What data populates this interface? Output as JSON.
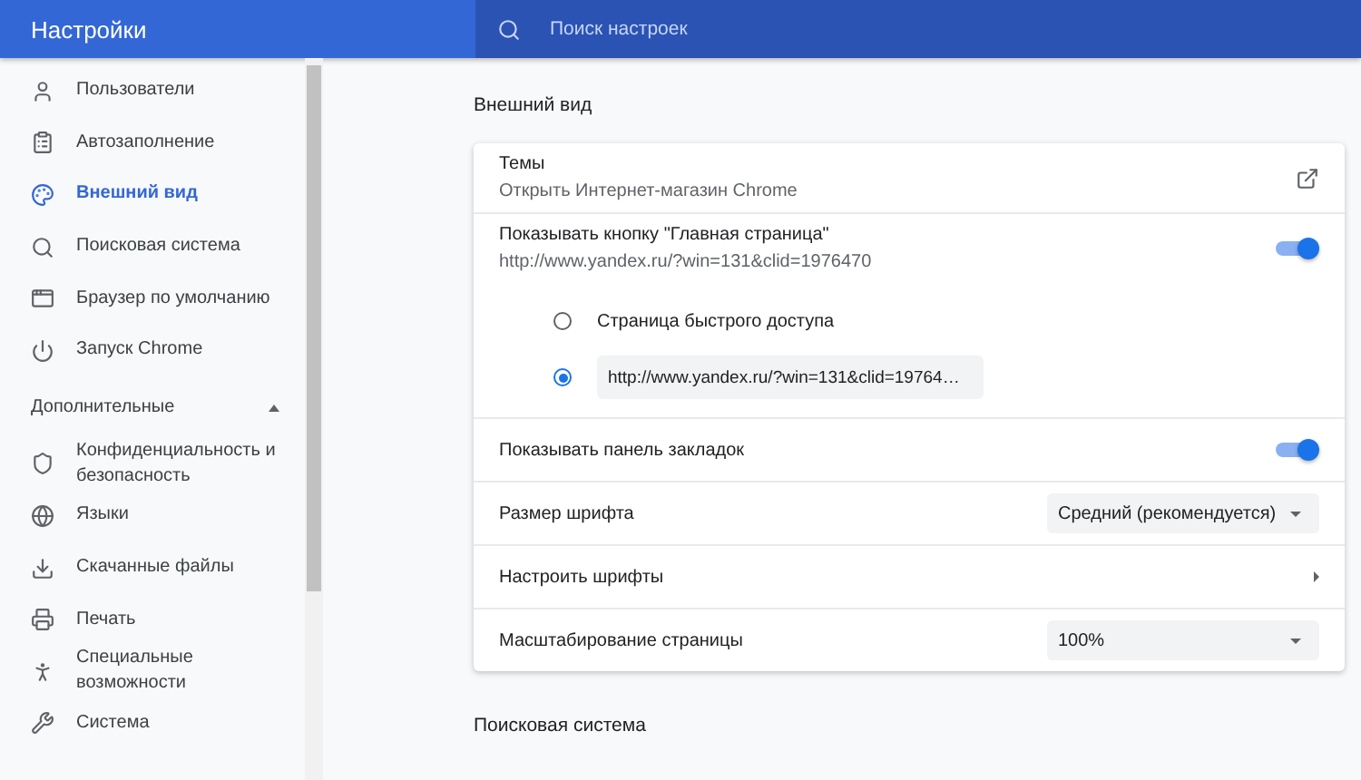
{
  "header": {
    "title": "Настройки"
  },
  "search": {
    "placeholder": "Поиск настроек"
  },
  "sidebar": {
    "items": [
      {
        "label": "Пользователи",
        "selected": false
      },
      {
        "label": "Автозаполнение",
        "selected": false
      },
      {
        "label": "Внешний вид",
        "selected": true
      },
      {
        "label": "Поисковая система",
        "selected": false
      },
      {
        "label": "Браузер по умолчанию",
        "selected": false
      },
      {
        "label": "Запуск Chrome",
        "selected": false
      }
    ],
    "advanced": {
      "label": "Дополнительные",
      "expanded": true
    },
    "advanced_items": [
      {
        "label": "Конфиденциальность и безопасность",
        "selected": false
      },
      {
        "label": "Языки",
        "selected": false
      },
      {
        "label": "Скачанные файлы",
        "selected": false
      },
      {
        "label": "Печать",
        "selected": false
      },
      {
        "label": "Специальные возможности",
        "selected": false
      },
      {
        "label": "Система",
        "selected": false
      }
    ]
  },
  "main": {
    "section_title": "Внешний вид",
    "rows": [
      {
        "kind": "link",
        "title": "Темы",
        "subtitle": "Открыть Интернет-магазин Chrome"
      },
      {
        "kind": "toggle",
        "title": "Показывать кнопку \"Главная страница\"",
        "subtitle": "http://www.yandex.ru/?win=131&clid=1976470",
        "on": true,
        "options": [
          {
            "kind": "text",
            "label": "Страница быстрого доступа",
            "selected": false
          },
          {
            "kind": "field",
            "value": "http://www.yandex.ru/?win=131&clid=19764…",
            "selected": true
          }
        ]
      },
      {
        "kind": "toggle",
        "title": "Показывать панель закладок",
        "on": true
      },
      {
        "kind": "select",
        "title": "Размер шрифта",
        "value": "Средний (рекомендуется)"
      },
      {
        "kind": "submenu",
        "title": "Настроить шрифты"
      },
      {
        "kind": "select",
        "title": "Масштабирование страницы",
        "value": "100%"
      }
    ],
    "next_section_title": "Поисковая система"
  }
}
